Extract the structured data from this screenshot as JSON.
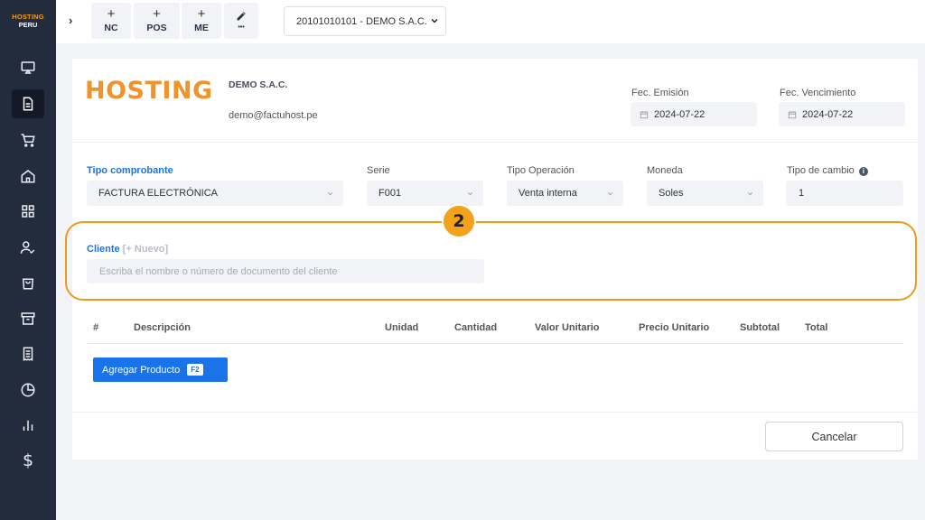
{
  "sidebar": {
    "logo_line1": "HOSTING",
    "logo_line2": "PERU",
    "items": [
      {
        "icon": "monitor-icon",
        "active": false
      },
      {
        "icon": "document-icon",
        "active": true
      },
      {
        "icon": "cart-icon",
        "active": false
      },
      {
        "icon": "home-icon",
        "active": false
      },
      {
        "icon": "grid-icon",
        "active": false
      },
      {
        "icon": "user-check-icon",
        "active": false
      },
      {
        "icon": "shopping-bag-icon",
        "active": false
      },
      {
        "icon": "archive-icon",
        "active": false
      },
      {
        "icon": "receipt-icon",
        "active": false
      },
      {
        "icon": "pie-chart-icon",
        "active": false
      },
      {
        "icon": "bar-chart-icon",
        "active": false
      },
      {
        "icon": "dollar-icon",
        "active": false,
        "glyph": "$"
      }
    ]
  },
  "topbar": {
    "expand_glyph": "›",
    "buttons": [
      {
        "symbol": "+",
        "label": "NC"
      },
      {
        "symbol": "+",
        "label": "POS"
      },
      {
        "symbol": "+",
        "label": "ME"
      },
      {
        "symbol": "pencil",
        "label": "•••"
      }
    ],
    "company_select": "20101010101 - DEMO S.A.C."
  },
  "invoice": {
    "brand": "HOSTING",
    "company_name": "DEMO S.A.C.",
    "company_email": "demo@factuhost.pe",
    "fec_emision_label": "Fec. Emisión",
    "fec_emision": "2024-07-22",
    "fec_vencimiento_label": "Fec. Vencimiento",
    "fec_vencimiento": "2024-07-22",
    "fields": {
      "tipo_comprobante_label": "Tipo comprobante",
      "tipo_comprobante": "FACTURA ELECTRÓNICA",
      "serie_label": "Serie",
      "serie": "F001",
      "tipo_operacion_label": "Tipo Operación",
      "tipo_operacion": "Venta interna",
      "moneda_label": "Moneda",
      "moneda": "Soles",
      "tipo_cambio_label": "Tipo de cambio",
      "tipo_cambio": "1"
    },
    "cliente_label": "Cliente",
    "cliente_nuevo": "[+ Nuevo]",
    "cliente_placeholder": "Escriba el nombre o número de documento del cliente",
    "step_number": "2",
    "table_headers": [
      "#",
      "Descripción",
      "Unidad",
      "Cantidad",
      "Valor Unitario",
      "Precio Unitario",
      "Subtotal",
      "Total"
    ],
    "add_product_label": "Agregar Producto",
    "add_product_shortcut": "F2",
    "cancel_label": "Cancelar"
  },
  "colors": {
    "sidebar_bg": "#232c3d",
    "accent_blue": "#1a73e8",
    "brand_orange": "#f0932b",
    "highlight_orange": "#ee9b1c"
  }
}
